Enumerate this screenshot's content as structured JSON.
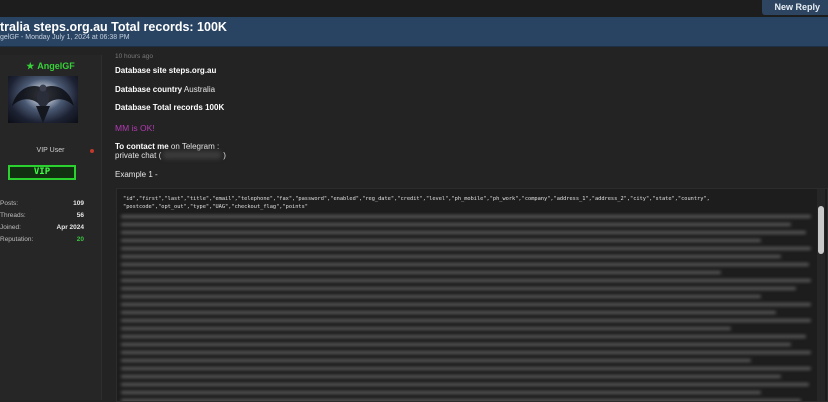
{
  "toolbar": {
    "new_reply": "New Reply"
  },
  "thread": {
    "title": "tralia steps.org.au Total records: 100K",
    "meta": "gelGF - Monday July 1, 2024 at 06:38 PM"
  },
  "user": {
    "star": "★",
    "name": "AngelGF",
    "title": "VIP User",
    "badge": "VIP",
    "stats": [
      {
        "label": "Posts:",
        "value": "109"
      },
      {
        "label": "Threads:",
        "value": "56"
      },
      {
        "label": "Joined:",
        "value": "Apr 2024"
      },
      {
        "label": "Reputation:",
        "value": "20"
      }
    ]
  },
  "post": {
    "timestamp": "10 hours ago",
    "site_label": "Database site steps.org.au",
    "country_label": "Database country",
    "country_value": "Australia",
    "total_label": "Database  Total records 100K",
    "mm_text": "MM is OK!",
    "contact_label": "To contact me",
    "contact_rest": "on Telegram :",
    "private_chat_prefix": "private chat (",
    "private_chat_suffix": ")",
    "example_label": "Example 1 -",
    "code_header_1": "\"id\",\"first\",\"last\",\"title\",\"email\",\"telephone\",\"fax\",\"password\",\"enabled\",\"reg_date\",\"credit\",\"level\",\"ph_mobile\",\"ph_work\",\"company\",\"address_1\",\"address_2\",\"city\",\"state\",\"country\",",
    "code_header_2": "\"postcode\",\"opt_out\",\"type\",\"UAG\",\"checkout_flag\",\"points\""
  },
  "colors": {
    "header_bg": "#294463",
    "username": "#38d13a",
    "mm_text": "#b23ab2",
    "vip_border": "#2ad12f"
  }
}
